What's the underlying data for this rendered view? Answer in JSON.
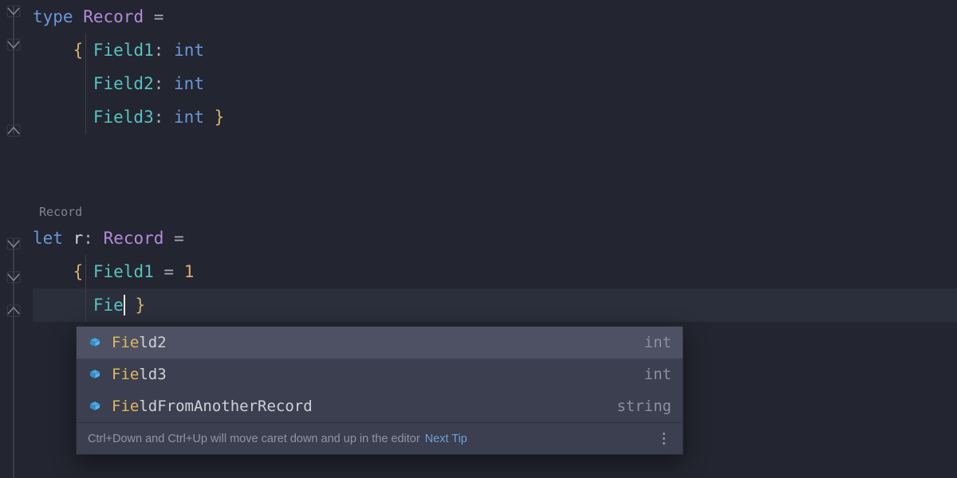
{
  "code": {
    "lines": [
      {
        "kind": "type_decl",
        "tokens": [
          "type",
          " ",
          "Record",
          " ",
          "="
        ]
      },
      {
        "kind": "field_first",
        "tokens": [
          "    ",
          "{",
          " ",
          "Field1",
          ":",
          " ",
          "int"
        ]
      },
      {
        "kind": "field",
        "tokens": [
          "      ",
          "Field2",
          ":",
          " ",
          "int"
        ]
      },
      {
        "kind": "field_last",
        "tokens": [
          "      ",
          "Field3",
          ":",
          " ",
          "int",
          " ",
          "}"
        ]
      },
      {
        "kind": "blank",
        "tokens": [
          ""
        ]
      },
      {
        "kind": "blank",
        "tokens": [
          ""
        ]
      },
      {
        "kind": "inlay",
        "inlay": "Record"
      },
      {
        "kind": "let_decl",
        "tokens": [
          "let",
          " ",
          "r",
          ":",
          " ",
          "Record",
          " ",
          "="
        ]
      },
      {
        "kind": "rec_first",
        "tokens": [
          "    ",
          "{",
          " ",
          "Field1",
          " ",
          "=",
          " ",
          "1"
        ]
      },
      {
        "kind": "rec_typing",
        "tokens": [
          "      ",
          "Fie",
          "CARET",
          " ",
          "}"
        ]
      }
    ],
    "current_line_index": 9
  },
  "completion": {
    "typed": "Fie",
    "items": [
      {
        "label_prefix": "Fie",
        "label_rest": "ld2",
        "type": "int",
        "selected": true
      },
      {
        "label_prefix": "Fie",
        "label_rest": "ld3",
        "type": "int",
        "selected": false
      },
      {
        "label_prefix": "Fie",
        "label_rest": "ldFromAnotherRecord",
        "type": "string",
        "selected": false
      }
    ],
    "footer_hint": "Ctrl+Down and Ctrl+Up will move caret down and up in the editor",
    "footer_link": "Next Tip"
  }
}
